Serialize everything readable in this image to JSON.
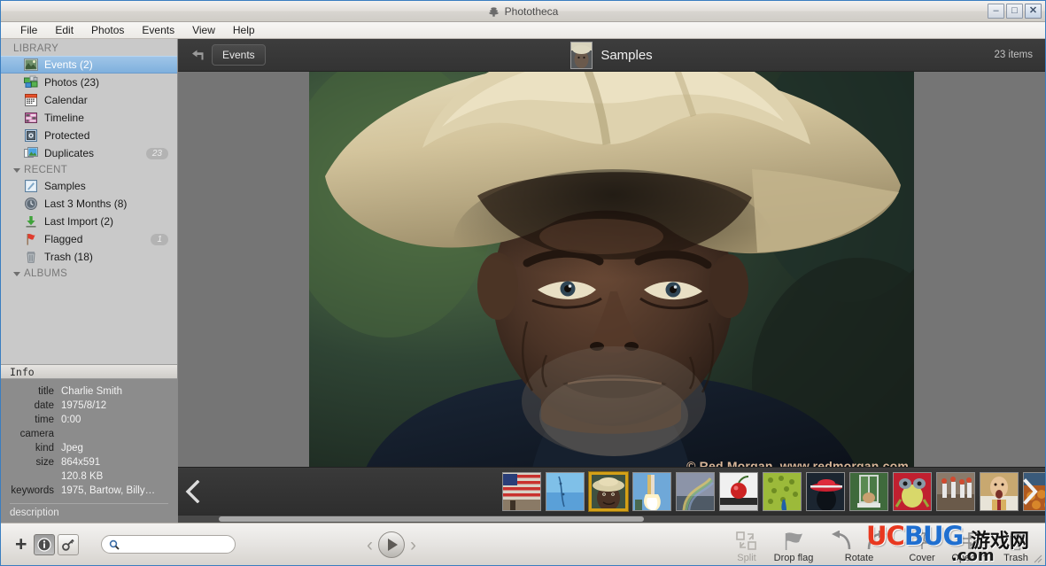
{
  "window": {
    "title": "Phototheca",
    "title_icon": "hive-icon",
    "minimize_label": "–",
    "maximize_label": "□",
    "close_label": "✕"
  },
  "menubar": {
    "items": [
      {
        "label": "File"
      },
      {
        "label": "Edit"
      },
      {
        "label": "Photos"
      },
      {
        "label": "Events"
      },
      {
        "label": "View"
      },
      {
        "label": "Help"
      }
    ]
  },
  "sidebar": {
    "groups": [
      {
        "label": "LIBRARY",
        "collapsible": false,
        "items": [
          {
            "label": "Events (2)",
            "icon": "events-icon",
            "selected": true,
            "badge": ""
          },
          {
            "label": "Photos (23)",
            "icon": "photos-icon",
            "selected": false,
            "badge": ""
          },
          {
            "label": "Calendar",
            "icon": "calendar-icon",
            "selected": false,
            "badge": ""
          },
          {
            "label": "Timeline",
            "icon": "timeline-icon",
            "selected": false,
            "badge": ""
          },
          {
            "label": "Protected",
            "icon": "protected-icon",
            "selected": false,
            "badge": ""
          },
          {
            "label": "Duplicates",
            "icon": "duplicates-icon",
            "selected": false,
            "badge": "23"
          }
        ]
      },
      {
        "label": "RECENT",
        "collapsible": true,
        "items": [
          {
            "label": "Samples",
            "icon": "samples-icon",
            "selected": false,
            "badge": ""
          },
          {
            "label": "Last 3 Months (8)",
            "icon": "clock-icon",
            "selected": false,
            "badge": ""
          },
          {
            "label": "Last Import (2)",
            "icon": "import-icon",
            "selected": false,
            "badge": ""
          },
          {
            "label": "Flagged",
            "icon": "flag-icon",
            "selected": false,
            "badge": "1"
          },
          {
            "label": "Trash (18)",
            "icon": "trash-icon",
            "selected": false,
            "badge": ""
          }
        ]
      },
      {
        "label": "ALBUMS",
        "collapsible": true,
        "items": []
      }
    ]
  },
  "info_panel": {
    "header": "Info",
    "rows": [
      {
        "key": "title",
        "value": "Charlie Smith"
      },
      {
        "key": "date",
        "value": "1975/8/12"
      },
      {
        "key": "time",
        "value": "0:00"
      },
      {
        "key": "camera",
        "value": ""
      },
      {
        "key": "kind",
        "value": "Jpeg"
      },
      {
        "key": "size",
        "value": "864x591"
      },
      {
        "key": "",
        "value": "120.8 KB"
      },
      {
        "key": "keywords",
        "value": "1975, Bartow, Billy…"
      }
    ],
    "description_label": "description"
  },
  "topbar": {
    "back_icon": "back-arrow-icon",
    "back_button_label": "Events",
    "title": "Samples",
    "thumb_icon": "event-thumbnail",
    "items_count": "23 items"
  },
  "viewer": {
    "photo_caption": "© Red Morgan, www.redmorgan.com",
    "photo_alt": "portrait of elderly man wearing a cream cowboy hat"
  },
  "filmstrip": {
    "prev_arrow": "‹",
    "next_arrow": "›",
    "selected_index": 2,
    "thumbs": [
      {
        "name": "american-flag"
      },
      {
        "name": "blue-water"
      },
      {
        "name": "charlie-smith-portrait"
      },
      {
        "name": "rocket-launch"
      },
      {
        "name": "rainbow"
      },
      {
        "name": "cherry"
      },
      {
        "name": "peacock"
      },
      {
        "name": "red-hat-silhouette"
      },
      {
        "name": "cat-in-window"
      },
      {
        "name": "frog"
      },
      {
        "name": "runners"
      },
      {
        "name": "man-shouting"
      },
      {
        "name": "autumn-market"
      }
    ]
  },
  "bottombar": {
    "add_label": "+",
    "info_toggle": "info-icon",
    "key_toggle": "key-icon",
    "search": {
      "value": "",
      "placeholder": ""
    },
    "prev_label": "‹",
    "play_label": "▶",
    "next_label": "›",
    "tools": [
      {
        "label": "Split",
        "icon": "split-icon",
        "disabled": true
      },
      {
        "label": "Drop flag",
        "icon": "flag-icon",
        "disabled": false
      },
      {
        "label": "Rotate",
        "icon": "rotate-icon",
        "disabled": false
      },
      {
        "label": "Cover",
        "icon": "pin-icon",
        "disabled": false
      },
      {
        "label": "Open In",
        "icon": "open-in-icon",
        "disabled": false
      },
      {
        "label": "Trash",
        "icon": "trash-icon",
        "disabled": false
      }
    ]
  },
  "watermark": {
    "part1": "UC",
    "part2": "BUG",
    "part3": "游戏网",
    "part4": ".com"
  },
  "colors": {
    "selection_blue": "#8fbbe3",
    "sidebar_bg": "#c9c9c9",
    "info_bg": "#8c8c8c",
    "viewer_bg": "#757575",
    "topbar_bg": "#383838",
    "filmstrip_bg": "#333333",
    "thumb_selected": "#d4a017",
    "watermark_red": "#e8381f",
    "watermark_blue": "#1f6fd0"
  }
}
